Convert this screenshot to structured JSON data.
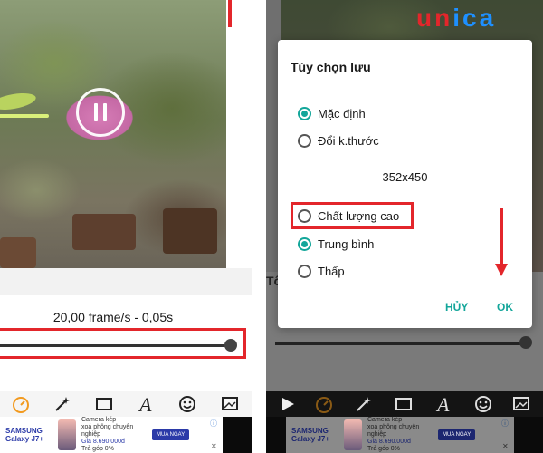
{
  "brand": {
    "logo_letters": [
      "u",
      "n",
      "i",
      "c",
      "a"
    ],
    "logo_colors": [
      "#e3262b",
      "#e3262b",
      "#1e90ff",
      "#1e90ff",
      "#1e90ff"
    ]
  },
  "left": {
    "frame_info": "20,00 frame/s - 0,05s",
    "slider_level": 1.0
  },
  "right": {
    "partial_label": "Tốc",
    "dialog": {
      "title": "Tùy chọn lưu",
      "options_top": [
        {
          "label": "Mặc định",
          "selected": true
        },
        {
          "label": "Đổi k.thước",
          "selected": false
        }
      ],
      "size": "352x450",
      "options_bottom": [
        {
          "label": "Chất lượng cao",
          "selected": false
        },
        {
          "label": "Trung bình",
          "selected": true
        },
        {
          "label": "Thấp",
          "selected": false
        }
      ],
      "cancel_label": "HỦY",
      "ok_label": "OK"
    }
  },
  "ad": {
    "brand": "SAMSUNG Galaxy J7+",
    "line1": "Camera kép",
    "line2": "xoá phông chuyên nghiệp",
    "price": "Giá 8.690.000đ",
    "line3": "Trả góp 0%",
    "cta": "MUA NGAY",
    "info": "ⓘ",
    "close": "✕"
  },
  "toolbar": {
    "icons": [
      "play-icon",
      "timer-icon",
      "magic-wand-icon",
      "crop-icon",
      "text-icon",
      "smiley-icon",
      "save-image-icon"
    ]
  },
  "colors": {
    "accent": "#13a69a",
    "highlight": "#e3262b"
  }
}
